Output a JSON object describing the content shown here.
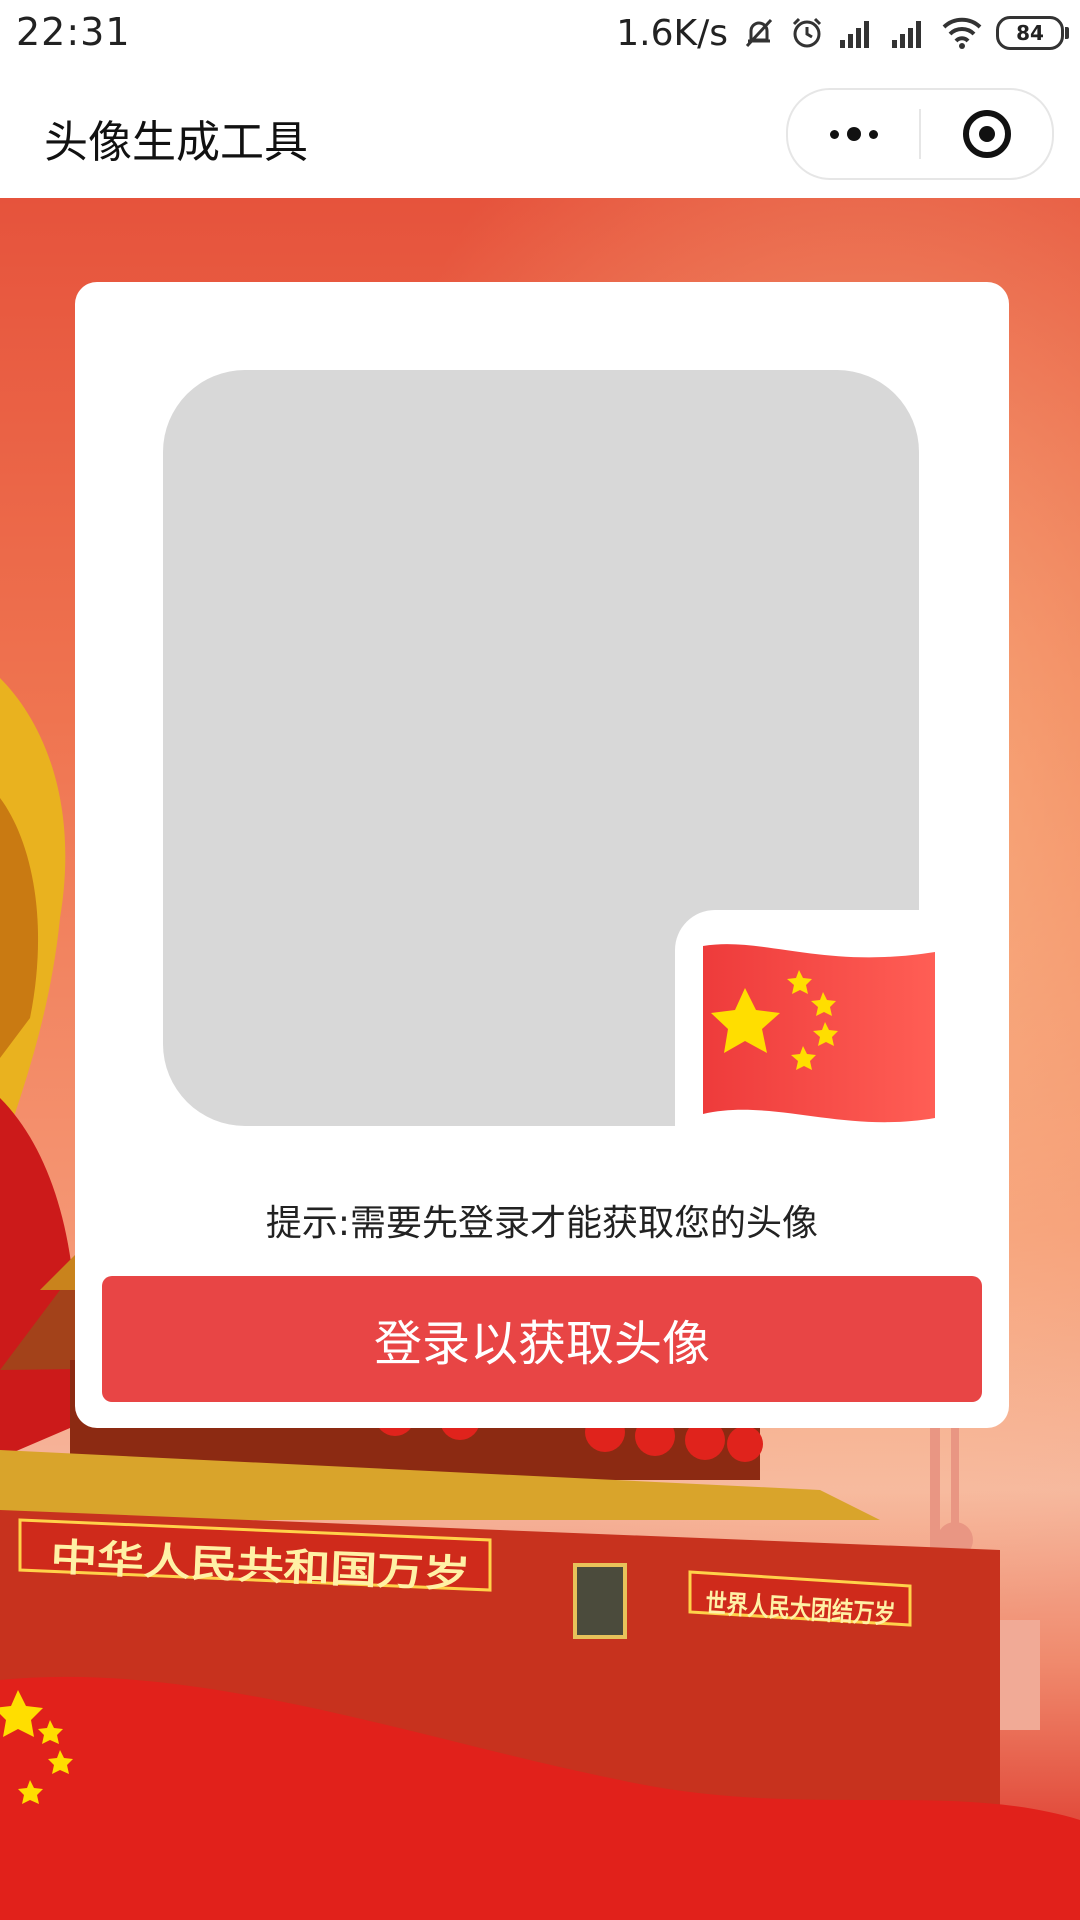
{
  "status_bar": {
    "time": "22:31",
    "net_speed": "1.6K/s",
    "battery": "84"
  },
  "header": {
    "title": "头像生成工具"
  },
  "card": {
    "hint": "提示:需要先登录才能获取您的头像",
    "login_button": "登录以获取头像"
  },
  "scene": {
    "left_banner": "中华人民共和国万岁",
    "right_banner": "世界人民大团结万岁"
  },
  "colors": {
    "accent": "#e84545",
    "placeholder": "#d8d8d8",
    "flag_red": "#ee3b3b",
    "flag_star": "#ffde00"
  }
}
